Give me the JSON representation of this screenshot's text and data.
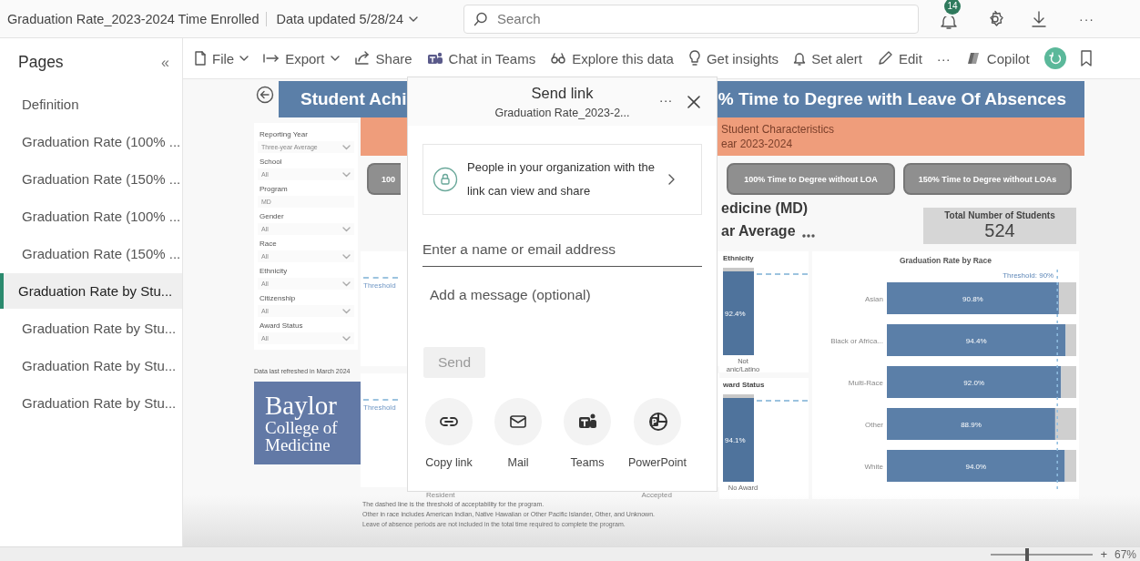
{
  "header": {
    "title": "Graduation Rate_2023-2024 Time Enrolled",
    "updated": "Data updated 5/28/24",
    "search": {
      "placeholder": "Search"
    },
    "notifications": "14",
    "more": "···"
  },
  "pages_pane": {
    "title": "Pages",
    "collapse": "«",
    "items": [
      {
        "label": "Definition",
        "selected": false
      },
      {
        "label": "Graduation Rate (100% ...",
        "selected": false
      },
      {
        "label": "Graduation Rate (150% ...",
        "selected": false
      },
      {
        "label": "Graduation Rate (100% ...",
        "selected": false
      },
      {
        "label": "Graduation Rate (150% ...",
        "selected": false
      },
      {
        "label": "Graduation Rate by Stu...",
        "selected": true
      },
      {
        "label": "Graduation Rate by Stu...",
        "selected": false
      },
      {
        "label": "Graduation Rate by Stu...",
        "selected": false
      },
      {
        "label": "Graduation Rate by Stu...",
        "selected": false
      }
    ]
  },
  "toolbar": [
    {
      "label": "File",
      "dropdown": true
    },
    {
      "label": "Export",
      "dropdown": true
    },
    {
      "label": "Share",
      "dropdown": false
    },
    {
      "label": "Chat in Teams",
      "dropdown": false
    },
    {
      "label": "Explore this data",
      "dropdown": false
    },
    {
      "label": "Get insights",
      "dropdown": false
    },
    {
      "label": "Set alert",
      "dropdown": false
    },
    {
      "label": "Edit",
      "dropdown": false
    },
    {
      "label": "···",
      "dropdown": false
    },
    {
      "label": "Copilot",
      "dropdown": false
    }
  ],
  "report": {
    "title_left": "Student Achi",
    "title_right": "% Time to Degree with Leave Of Absences",
    "banner_lines": [
      "Student Characteristics",
      "ear 2023-2024"
    ],
    "slicers": [
      {
        "label": "Reporting Year",
        "value": "Three-year Average",
        "dropdown": true
      },
      {
        "label": "School",
        "value": "All",
        "dropdown": true
      },
      {
        "label": "Program",
        "value": "MD",
        "dropdown": false
      },
      {
        "label": "Gender",
        "value": "All",
        "dropdown": true
      },
      {
        "label": "Race",
        "value": "All",
        "dropdown": true
      },
      {
        "label": "Ethnicity",
        "value": "All",
        "dropdown": true
      },
      {
        "label": "Citizenship",
        "value": "All",
        "dropdown": true
      },
      {
        "label": "Award Status",
        "value": "All",
        "dropdown": true
      }
    ],
    "refreshed": "Data last refreshed in March 2024",
    "logo_lines": [
      "Baylor",
      "College of",
      "Medicine"
    ],
    "nav_buttons": [
      "100",
      "100% Time to Degree without LOA",
      "150% Time to Degree without LOAs"
    ],
    "headings": [
      "edicine (MD)",
      "ar Average"
    ],
    "total_card": {
      "label": "Total Number of Students",
      "value": "524"
    },
    "threshold_labels": [
      "Threshold",
      "Threshold"
    ],
    "bottom_labels": [
      "Resident",
      "Accepted"
    ],
    "side_charts": [
      {
        "title": "Ethnicity",
        "value_label": "92.4%",
        "axis_labels": [
          "Not",
          "anic/Latino"
        ]
      },
      {
        "title": "ward Status",
        "value_label": "94.1%",
        "axis_labels": [
          "No Award"
        ]
      }
    ],
    "race_chart": {
      "chart_data": {
        "type": "bar",
        "orientation": "horizontal",
        "title": "Graduation Rate by Race",
        "categories": [
          "Asian",
          "Black or Africa...",
          "Multi-Race",
          "Other",
          "White"
        ],
        "values": [
          90.8,
          94.4,
          92.0,
          88.9,
          94.0
        ],
        "xlim": [
          0,
          100
        ],
        "value_labels": [
          "90.8%",
          "94.4%",
          "92.0%",
          "88.9%",
          "94.0%"
        ],
        "ref_lines": [
          {
            "axis": "x",
            "value": 90,
            "label": "Threshold: 90%"
          }
        ]
      }
    },
    "footnotes": [
      "The dashed line is the threshold of acceptability for the program.",
      "Other in race includes American Indian, Native Hawaiian or Other Pacific Islander, Other, and Unknown.",
      "Leave of absence periods are not included in the total time required to complete the program."
    ]
  },
  "share_dialog": {
    "title": "Send link",
    "subtitle": "Graduation Rate_2023-2...",
    "more": "...",
    "permission": "People in your organization with the link can view and share",
    "recipient": {
      "placeholder": "Enter a name or email address"
    },
    "message": {
      "placeholder": "Add a message (optional)"
    },
    "send": {
      "label": "Send",
      "disabled": true
    },
    "options": [
      {
        "label": "Copy link"
      },
      {
        "label": "Mail"
      },
      {
        "label": "Teams"
      },
      {
        "label": "PowerPoint"
      }
    ]
  },
  "status_bar": {
    "zoom_in": "+",
    "zoom": "67%",
    "zoom_slider": {
      "level": 0.35
    }
  }
}
